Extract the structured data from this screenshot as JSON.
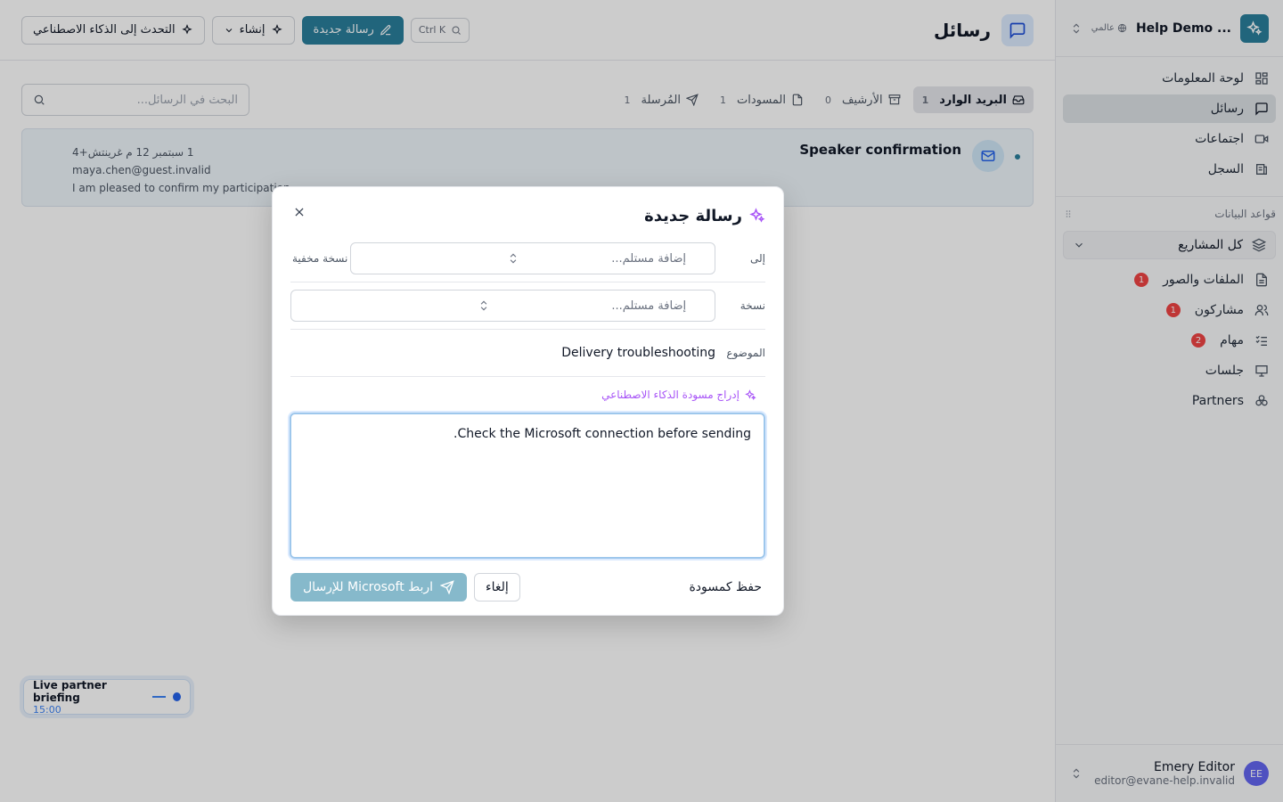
{
  "workspace": {
    "name": "Help Demo ...",
    "scope": "عالمي",
    "logo_icon": "sparkles-icon"
  },
  "nav": [
    {
      "label": "لوحة المعلومات",
      "icon": "dashboard-icon"
    },
    {
      "label": "رسائل",
      "icon": "message-icon",
      "active": true
    },
    {
      "label": "اجتماعات",
      "icon": "video-icon"
    },
    {
      "label": "السجل",
      "icon": "log-icon"
    }
  ],
  "databases": {
    "heading": "قواعد البيانات",
    "project_selector": "كل المشاريع",
    "items": [
      {
        "label": "الملفات والصور",
        "badge": "1",
        "icon": "file-icon"
      },
      {
        "label": "مشاركون",
        "badge": "1",
        "icon": "users-icon"
      },
      {
        "label": "مهام",
        "badge": "2",
        "icon": "tasks-icon"
      },
      {
        "label": "جلسات",
        "badge": "",
        "icon": "presentation-icon"
      },
      {
        "label": "Partners",
        "badge": "",
        "icon": "partners-icon"
      }
    ]
  },
  "user": {
    "name": "Emery Editor",
    "email": "editor@evane-help.invalid",
    "initials": "EE"
  },
  "header": {
    "title": "رسائل",
    "shortcut": "Ctrl K",
    "new_message_label": "رسالة جديدة",
    "create_label": "إنشاء",
    "ai_chat_label": "التحدث إلى الذكاء الاصطناعي"
  },
  "folders": [
    {
      "label": "البريد الوارد",
      "count": "1",
      "active": true
    },
    {
      "label": "الأرشيف",
      "count": "0"
    },
    {
      "label": "المسودات",
      "count": "1"
    },
    {
      "label": "المُرسلة",
      "count": "1"
    }
  ],
  "search": {
    "placeholder": "البحث في الرسائل..."
  },
  "messages": [
    {
      "subject": "Speaker confirmation",
      "date": "1 سبتمبر 12 م غرينتش+4",
      "from": "maya.chen@guest.invalid",
      "preview": "I am pleased to confirm my participation."
    }
  ],
  "briefing": {
    "title": "Live partner briefing",
    "time": "15:00"
  },
  "dialog": {
    "title": "رسالة جديدة",
    "to_label": "إلى",
    "cc_label": "نسخة",
    "bcc_label": "نسخة مخفية",
    "recipient_placeholder": "إضافة مستلم...",
    "subject_label": "الموضوع",
    "subject_value": "Delivery troubleshooting",
    "ai_draft_label": "إدراج مسودة الذكاء الاصطناعي",
    "body": "Check the Microsoft connection before sending.",
    "save_draft_label": "حفظ كمسودة",
    "cancel_label": "إلغاء",
    "send_label": "اربط Microsoft للإرسال"
  },
  "colors": {
    "brand": "#2a7f9c",
    "badge": "#ef4444",
    "ai": "#a855f7"
  }
}
